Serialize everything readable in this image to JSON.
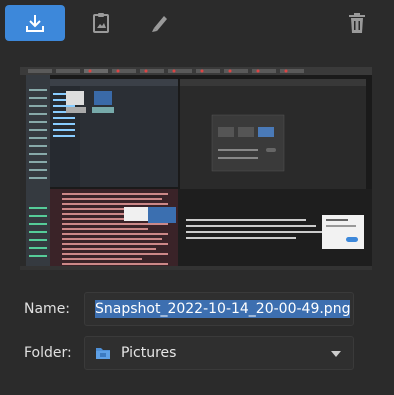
{
  "toolbar": {
    "items": [
      {
        "icon": "save-download-icon",
        "active": true
      },
      {
        "icon": "copy-to-clipboard-icon",
        "active": false
      },
      {
        "icon": "edit-pen-icon",
        "active": false
      },
      {
        "icon": "trash-icon",
        "active": false
      }
    ]
  },
  "form": {
    "name_label": "Name:",
    "name_value": "Snapshot_2022-10-14_20-00-49.png",
    "folder_label": "Folder:",
    "folder_value": "Pictures",
    "folder_icon": "folder-icon"
  },
  "colors": {
    "accent": "#3d88da",
    "background": "#2b2b2b",
    "selection": "#3d6fb0"
  }
}
